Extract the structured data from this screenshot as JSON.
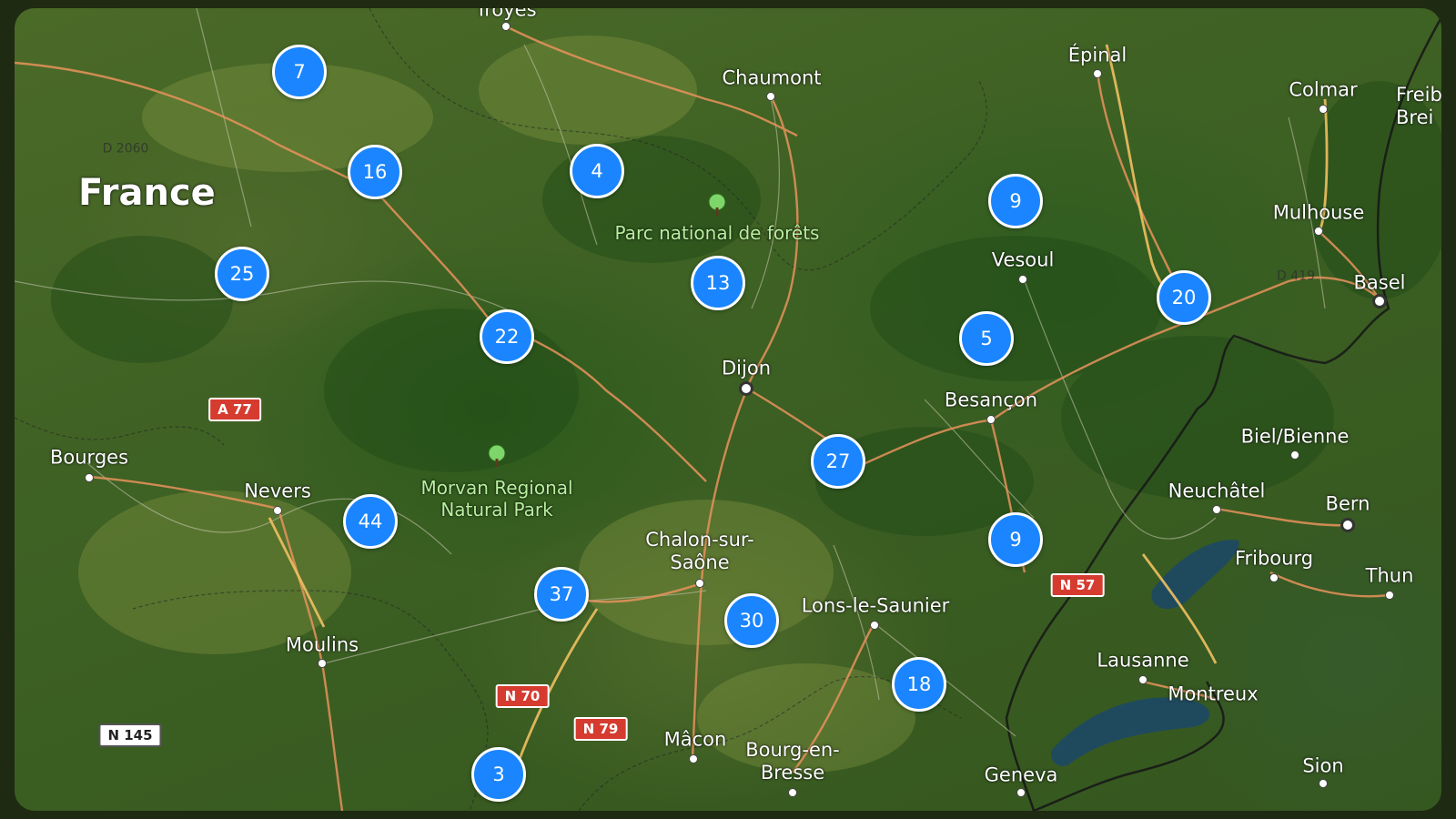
{
  "map": {
    "country_label": "France",
    "cities": [
      {
        "name": "Troyes",
        "kind": "city"
      },
      {
        "name": "Chaumont",
        "kind": "city"
      },
      {
        "name": "Épinal",
        "kind": "city"
      },
      {
        "name": "Colmar",
        "kind": "city"
      },
      {
        "name": "Freib Brei",
        "kind": "city"
      },
      {
        "name": "Mulhouse",
        "kind": "city"
      },
      {
        "name": "Basel",
        "kind": "city"
      },
      {
        "name": "Vesoul",
        "kind": "city"
      },
      {
        "name": "Dijon",
        "kind": "city"
      },
      {
        "name": "Besançon",
        "kind": "city"
      },
      {
        "name": "Biel/Bienne",
        "kind": "city"
      },
      {
        "name": "Neuchâtel",
        "kind": "city"
      },
      {
        "name": "Bern",
        "kind": "capital"
      },
      {
        "name": "Fribourg",
        "kind": "city"
      },
      {
        "name": "Thun",
        "kind": "city"
      },
      {
        "name": "Bourges",
        "kind": "city"
      },
      {
        "name": "Nevers",
        "kind": "city"
      },
      {
        "name": "Chalon-sur-Saône",
        "kind": "city"
      },
      {
        "name": "Lons-le-Saunier",
        "kind": "city"
      },
      {
        "name": "Moulins",
        "kind": "city"
      },
      {
        "name": "Lausanne",
        "kind": "city"
      },
      {
        "name": "Montreux",
        "kind": "city"
      },
      {
        "name": "Mâcon",
        "kind": "city"
      },
      {
        "name": "Bourg-en-Bresse",
        "kind": "city"
      },
      {
        "name": "Geneva",
        "kind": "city"
      },
      {
        "name": "Sion",
        "kind": "city"
      }
    ],
    "parks": [
      {
        "name": "Parc national de forêts"
      },
      {
        "name": "Morvan Regional Natural Park"
      }
    ],
    "road_shields": [
      {
        "label": "A 77",
        "style": "red"
      },
      {
        "label": "N 57",
        "style": "red"
      },
      {
        "label": "N 70",
        "style": "red"
      },
      {
        "label": "N 79",
        "style": "red"
      },
      {
        "label": "N 145",
        "style": "white"
      }
    ],
    "minor_labels": [
      "D 2060",
      "D 419"
    ],
    "clusters": [
      {
        "count": "7"
      },
      {
        "count": "16"
      },
      {
        "count": "4"
      },
      {
        "count": "9"
      },
      {
        "count": "25"
      },
      {
        "count": "13"
      },
      {
        "count": "20"
      },
      {
        "count": "22"
      },
      {
        "count": "5"
      },
      {
        "count": "27"
      },
      {
        "count": "44"
      },
      {
        "count": "9"
      },
      {
        "count": "37"
      },
      {
        "count": "30"
      },
      {
        "count": "18"
      },
      {
        "count": "3"
      }
    ],
    "colors": {
      "cluster_fill": "#1a85ff",
      "cluster_border": "#ffffff",
      "road_major": "#e8935c",
      "road_minor": "#c9c9b0",
      "motorway": "#f0c060",
      "border": "#1a1a1a",
      "park_label": "#b9f0a0",
      "lake": "#1f4a5e"
    }
  }
}
